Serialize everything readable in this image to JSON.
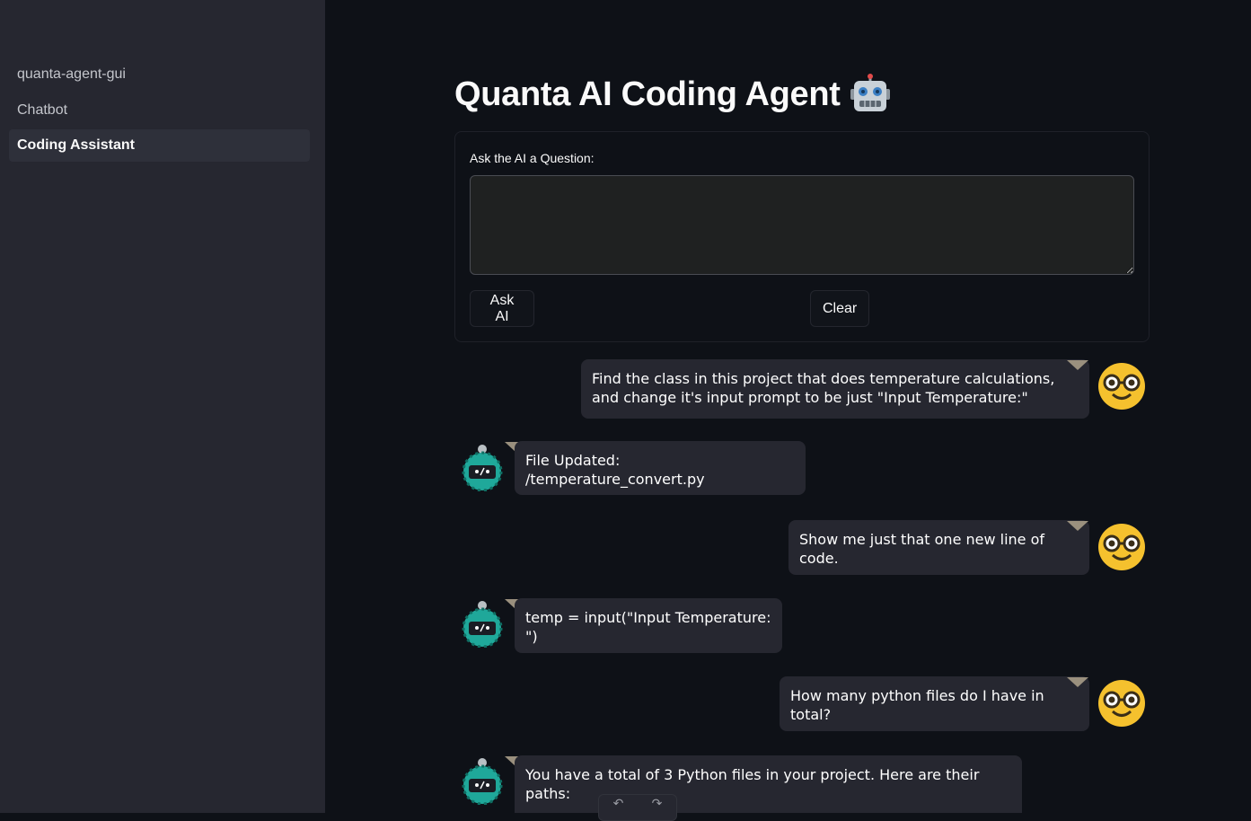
{
  "sidebar": {
    "items": [
      {
        "label": "quanta-agent-gui",
        "active": false
      },
      {
        "label": "Chatbot",
        "active": false
      },
      {
        "label": "Coding Assistant",
        "active": true
      }
    ]
  },
  "main": {
    "title": "Quanta AI Coding Agent",
    "title_emoji_icon": "robot-face-icon"
  },
  "form": {
    "label": "Ask the AI a Question:",
    "input_value": "",
    "ask_button": "Ask AI",
    "clear_button": "Clear"
  },
  "messages": [
    {
      "role": "user",
      "text": "Find the class in this project that does temperature calculations, and change it's input prompt to be just \"Input Temperature:\"",
      "avatar_icon": "nerd-face-icon"
    },
    {
      "role": "assistant",
      "text": "File Updated: /temperature_convert.py",
      "avatar_icon": "robot-avatar-icon"
    },
    {
      "role": "user",
      "text": "Show me just that one new line of code.",
      "avatar_icon": "nerd-face-icon"
    },
    {
      "role": "assistant",
      "text": "temp = input(\"Input Temperature: \")",
      "avatar_icon": "robot-avatar-icon"
    },
    {
      "role": "user",
      "text": "How many python files do I have in total?",
      "avatar_icon": "nerd-face-icon"
    },
    {
      "role": "assistant",
      "text": "You have a total of 3 Python files in your project. Here are their paths:",
      "avatar_icon": "robot-avatar-icon"
    }
  ],
  "toolbar": {
    "undo_icon": "undo-icon",
    "redo_icon": "redo-icon",
    "undo_glyph": "↶",
    "redo_glyph": "↷"
  },
  "colors": {
    "background": "#0e1117",
    "sidebar": "#262730",
    "bubble": "#262730",
    "user_avatar": "#f5c12e",
    "bot_avatar": "#1fa89a"
  }
}
